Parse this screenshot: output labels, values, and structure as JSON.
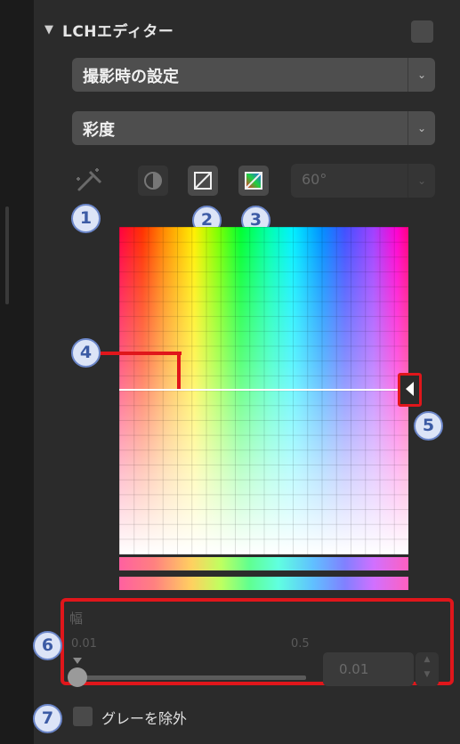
{
  "header": {
    "title": "LCHエディター"
  },
  "selects": {
    "preset": "撮影時の設定",
    "mode": "彩度"
  },
  "toolbar": {
    "hue_range_value": "60°"
  },
  "callouts": [
    "1",
    "2",
    "3",
    "4",
    "5",
    "6",
    "7"
  ],
  "width_control": {
    "label": "幅",
    "min_label": "0.01",
    "max_label": "0.5",
    "value": "0.01"
  },
  "exclude_gray": {
    "label": "グレーを除外"
  },
  "colors": {
    "accent": "#e0161b",
    "callout_bg": "#dce4f7",
    "callout_border": "#6b86c9"
  }
}
